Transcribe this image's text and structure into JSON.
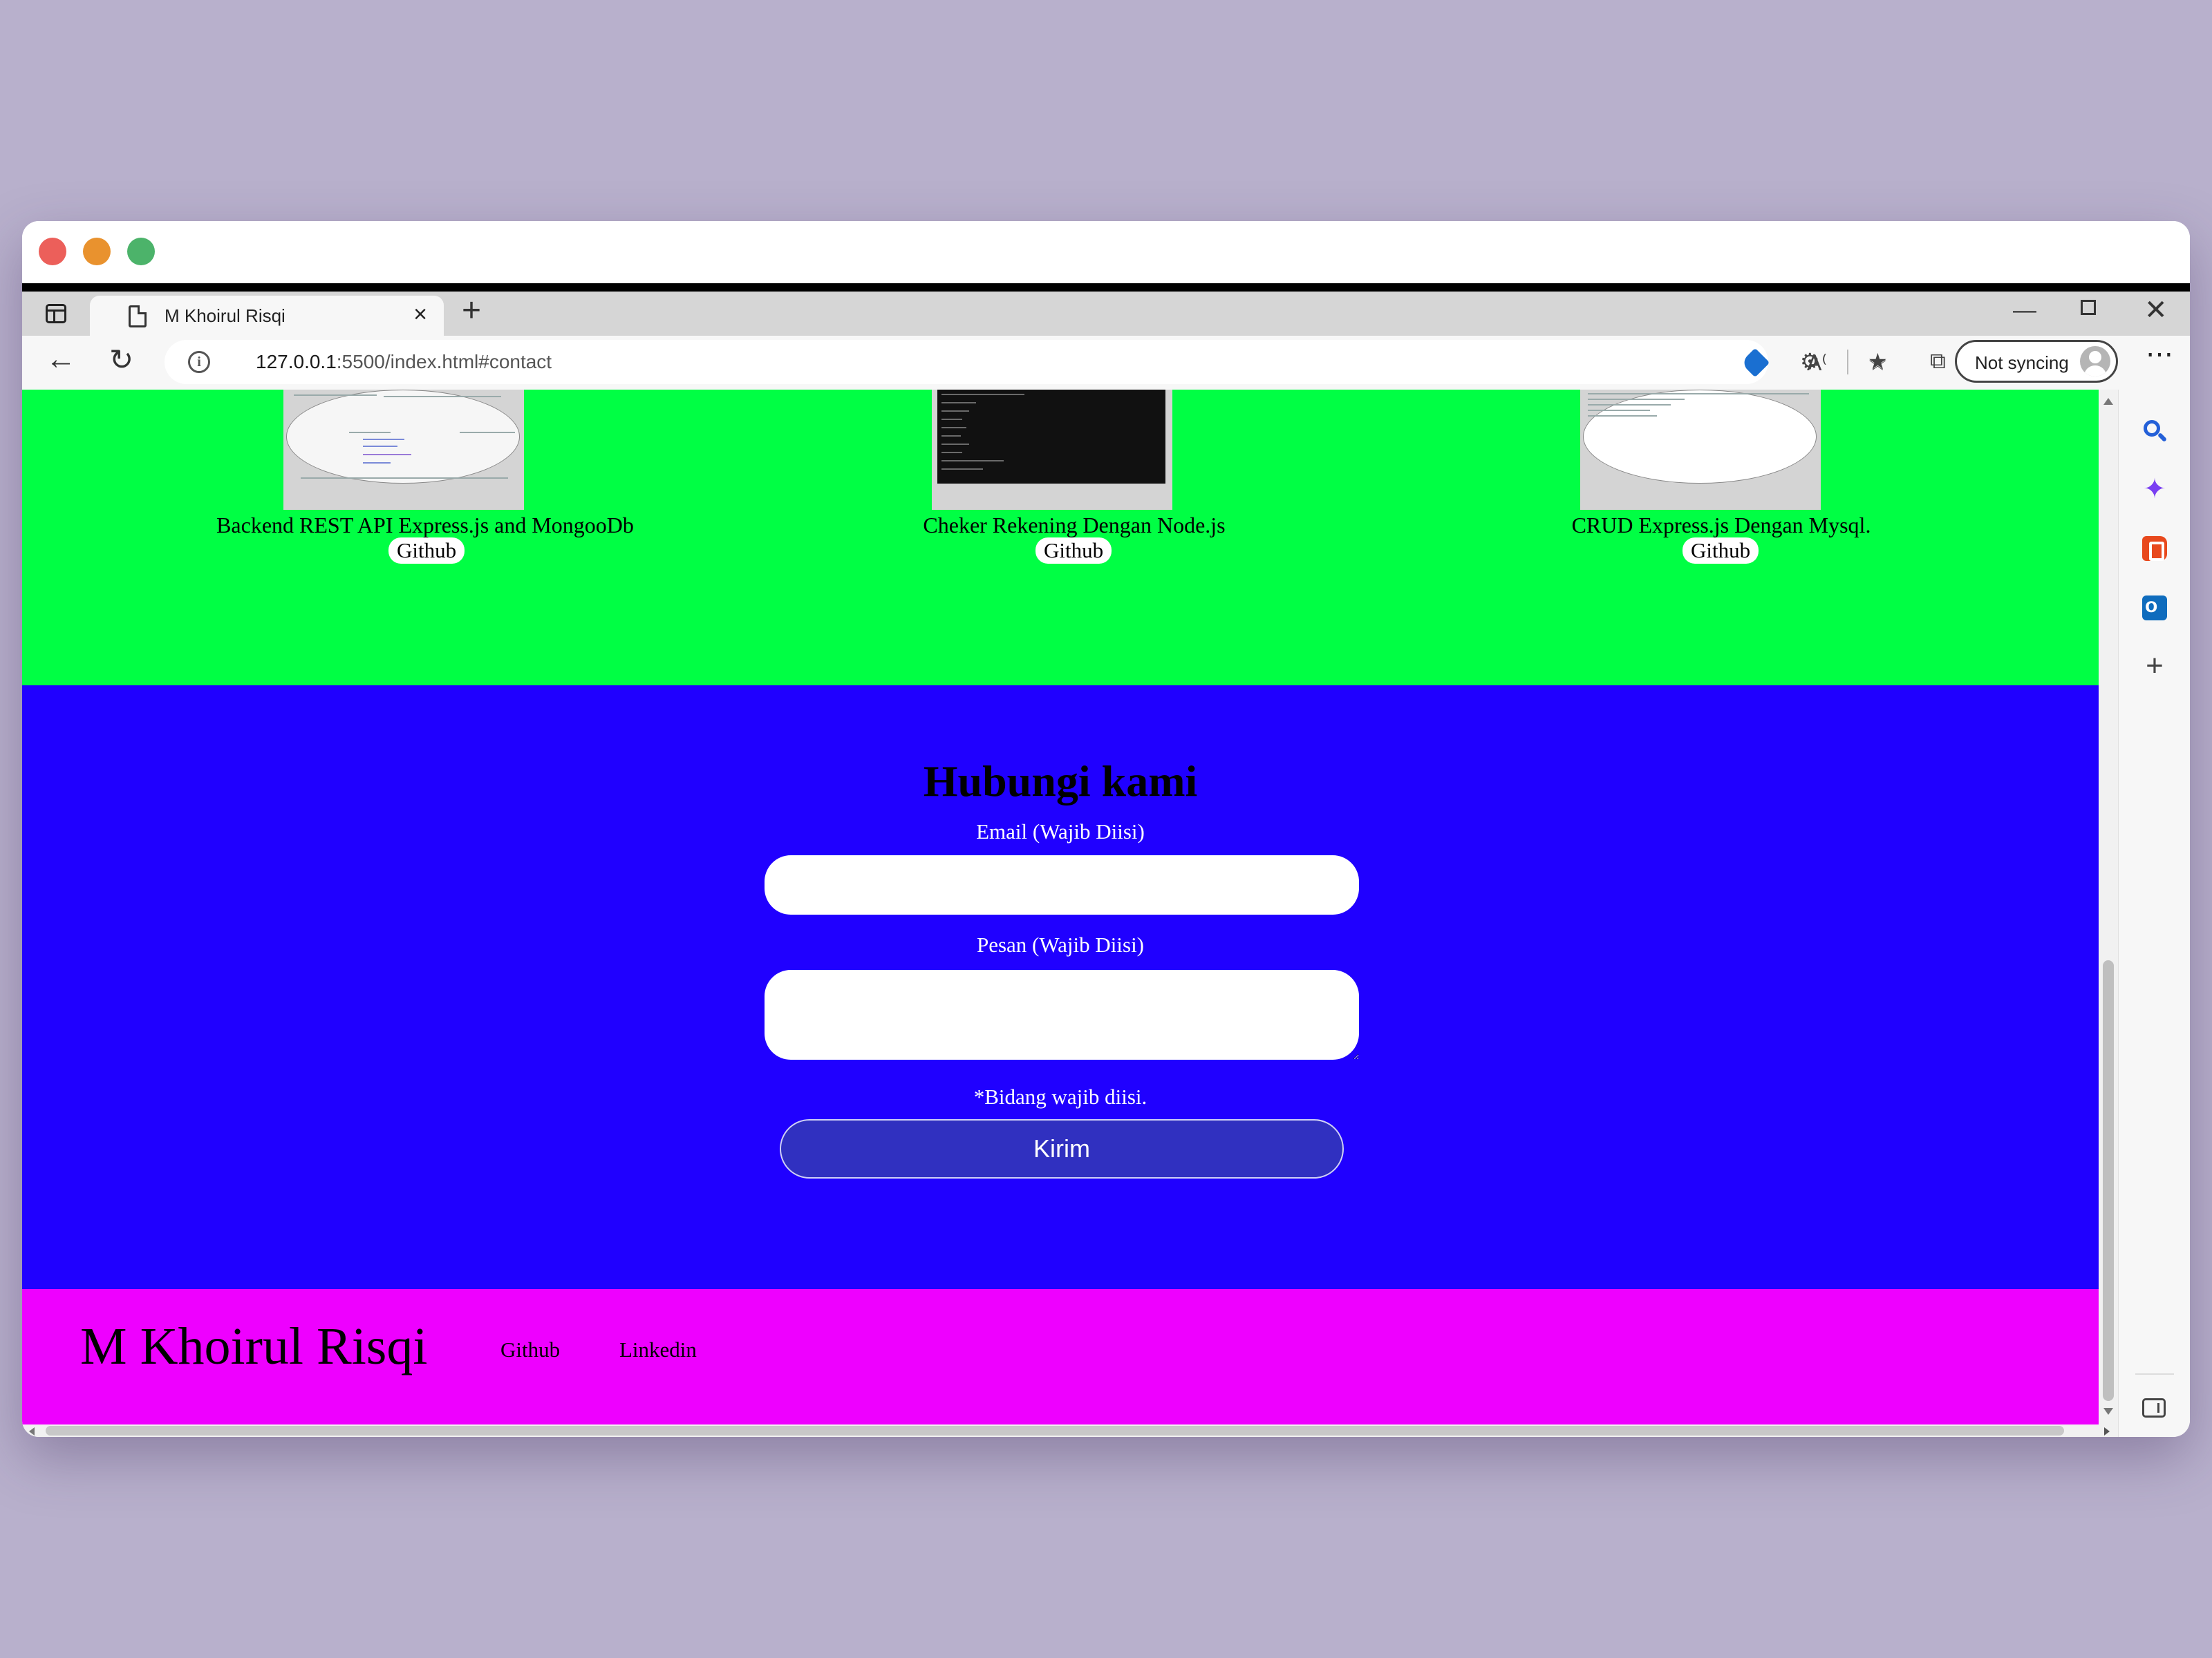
{
  "browser": {
    "tab_title": "M Khoirul Risqi",
    "url_host": "127.0.0.1",
    "url_rest": ":5500/index.html#contact",
    "sync_label": "Not syncing",
    "new_tab_glyph": "+",
    "close_tab_glyph": "×"
  },
  "projects": [
    {
      "title": "Backend REST API Express.js and MongooDb",
      "link_label": "Github",
      "thumbnail": "light-code-screenshot"
    },
    {
      "title": "Cheker Rekening Dengan Node.js",
      "link_label": "Github",
      "thumbnail": "dark-terminal-screenshot"
    },
    {
      "title": "CRUD Express.js Dengan Mysql.",
      "link_label": "Github",
      "thumbnail": "light-page-screenshot"
    }
  ],
  "contact": {
    "heading": "Hubungi kami",
    "email_label": "Email (Wajib Diisi)",
    "message_label": "Pesan (Wajib Diisi)",
    "email_value": "",
    "message_value": "",
    "required_note": "*Bidang wajib diisi.",
    "submit_label": "Kirim"
  },
  "footer": {
    "brand": "M Khoirul Risqi",
    "links": [
      "Github",
      "Linkedin"
    ]
  },
  "colors": {
    "projects_bg": "#00ff44",
    "contact_bg": "#2000ff",
    "footer_bg": "#ee00ff",
    "submit_bg": "#3030c0",
    "desktop_bg": "#b8b0cc"
  },
  "icons": {
    "sidebar": [
      "search-icon",
      "copilot-icon",
      "office-icon",
      "outlook-icon",
      "add-icon",
      "split-panel-icon",
      "settings-icon"
    ],
    "toolbar": [
      "back-icon",
      "reload-icon",
      "info-icon",
      "shopping-tag-icon",
      "read-aloud-icon",
      "add-favorite-icon",
      "extensions-icon",
      "favorites-icon",
      "collections-icon",
      "more-icon"
    ]
  }
}
